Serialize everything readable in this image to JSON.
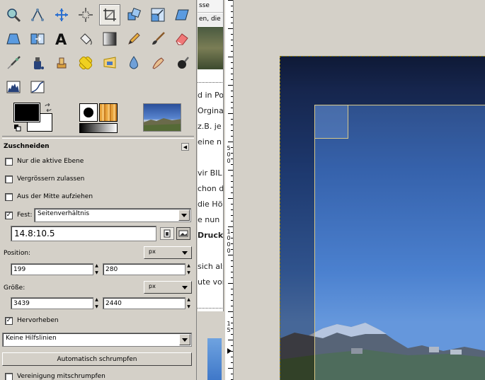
{
  "toolbox": {
    "tools": [
      {
        "name": "zoom-tool-icon",
        "row": 0,
        "col": 0
      },
      {
        "name": "paths-tool-icon",
        "row": 0,
        "col": 1
      },
      {
        "name": "move-tool-icon",
        "row": 0,
        "col": 2
      },
      {
        "name": "align-tool-icon",
        "row": 0,
        "col": 3
      },
      {
        "name": "crop-tool-icon",
        "row": 0,
        "col": 4,
        "active": true
      },
      {
        "name": "rotate-tool-icon",
        "row": 0,
        "col": 5
      },
      {
        "name": "scale-tool-icon",
        "row": 0,
        "col": 6
      },
      {
        "name": "shear-tool-icon",
        "row": 0,
        "col": 7
      },
      {
        "name": "perspective-tool-icon",
        "row": 1,
        "col": 0
      },
      {
        "name": "flip-tool-icon",
        "row": 1,
        "col": 1
      },
      {
        "name": "text-tool-icon",
        "row": 1,
        "col": 2
      },
      {
        "name": "bucket-fill-tool-icon",
        "row": 1,
        "col": 3
      },
      {
        "name": "blend-tool-icon",
        "row": 1,
        "col": 4
      },
      {
        "name": "pencil-tool-icon",
        "row": 1,
        "col": 5
      },
      {
        "name": "paintbrush-tool-icon",
        "row": 1,
        "col": 6
      },
      {
        "name": "eraser-tool-icon",
        "row": 1,
        "col": 7
      },
      {
        "name": "airbrush-tool-icon",
        "row": 2,
        "col": 0
      },
      {
        "name": "ink-tool-icon",
        "row": 2,
        "col": 1
      },
      {
        "name": "clone-tool-icon",
        "row": 2,
        "col": 2
      },
      {
        "name": "heal-tool-icon",
        "row": 2,
        "col": 3
      },
      {
        "name": "perspective-clone-tool-icon",
        "row": 2,
        "col": 4
      },
      {
        "name": "blur-tool-icon",
        "row": 2,
        "col": 5
      },
      {
        "name": "smudge-tool-icon",
        "row": 2,
        "col": 6
      },
      {
        "name": "dodge-burn-tool-icon",
        "row": 2,
        "col": 7
      },
      {
        "name": "levels-icon",
        "row": 3,
        "col": 0
      },
      {
        "name": "curves-icon",
        "row": 3,
        "col": 1
      }
    ]
  },
  "tool_options": {
    "title": "Zuschneiden",
    "only_active_layer": {
      "label": "Nur die aktive Ebene",
      "checked": false
    },
    "allow_growing": {
      "label": "Vergrössern zulassen",
      "checked": false
    },
    "from_center": {
      "label": "Aus der Mitte aufziehen",
      "checked": false
    },
    "fixed": {
      "label": "Fest:",
      "checked": true,
      "mode": "Seitenverhältnis",
      "ratio": "14.8:10.5"
    },
    "position": {
      "label": "Position:",
      "unit": "px",
      "x": "199",
      "y": "280"
    },
    "size": {
      "label": "Größe:",
      "unit": "px",
      "w": "3439",
      "h": "2440"
    },
    "highlight": {
      "label": "Hervorheben",
      "checked": true
    },
    "guides": "Keine Hilfslinien",
    "auto_shrink": "Automatisch schrumpfen",
    "shrink_merged": {
      "label": "Vereinigung mitschrumpfen",
      "checked": false
    }
  },
  "doc_panel": {
    "title_fragment": "sse",
    "sub_fragment": "en, die a",
    "lines": [
      "d in Po",
      "Orgina",
      "z.B. je",
      "eine n",
      "",
      "vir BIL",
      "chon d",
      "die Hö",
      "e nun",
      "Druck",
      "",
      "sich als",
      "ute vor"
    ]
  },
  "ruler": {
    "labels": [
      "5\n0\n0",
      "1\n0\n0\n0",
      "1\n5"
    ]
  },
  "colors": {
    "selection_border": "#d9c98a",
    "marching_ants": "#e0c000"
  }
}
